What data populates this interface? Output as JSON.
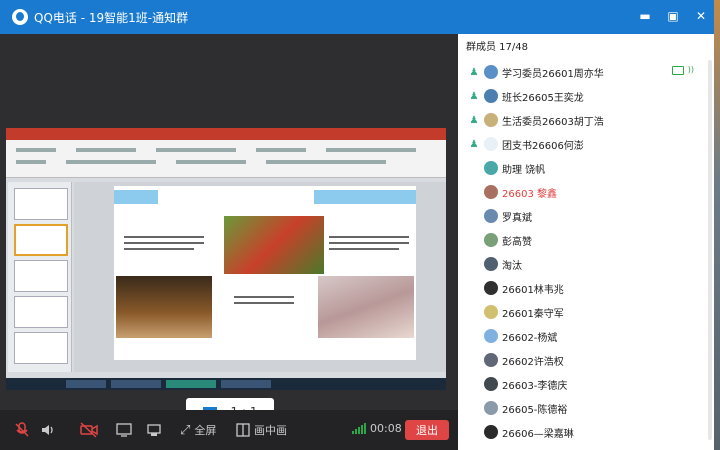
{
  "window": {
    "title": "QQ电话 - 19智能1班-通知群",
    "controls": [
      "▬",
      "▣",
      "✕"
    ]
  },
  "video": {
    "zoom_label": "1 : 1"
  },
  "toolbar": {
    "fullscreen_label": "全屏",
    "pip_label": "画中画",
    "timer": "00:08",
    "exit_label": "退出"
  },
  "members": {
    "header": "群成员 17/48",
    "list": [
      {
        "name": "学习委员26601周亦华",
        "owner": true,
        "color": "#5a8fc8",
        "highlight": false
      },
      {
        "name": "班长26605王奕龙",
        "owner": true,
        "color": "#4a7fb0",
        "highlight": false
      },
      {
        "name": "生活委员26603胡丁浩",
        "owner": true,
        "color": "#c8b07a",
        "highlight": false
      },
      {
        "name": "团支书26606何澎",
        "owner": true,
        "color": "#e8f0f8",
        "highlight": false
      },
      {
        "name": "助理  饶帆",
        "owner": false,
        "color": "#4aa8a8",
        "highlight": false
      },
      {
        "name": "26603 黎鑫",
        "owner": false,
        "color": "#a87060",
        "highlight": true
      },
      {
        "name": "罗真斌",
        "owner": false,
        "color": "#6a8ab0",
        "highlight": false
      },
      {
        "name": "彭高赞",
        "owner": false,
        "color": "#7aa07a",
        "highlight": false
      },
      {
        "name": "淘汰",
        "owner": false,
        "color": "#506070",
        "highlight": false
      },
      {
        "name": "26601林韦兆",
        "owner": false,
        "color": "#303030",
        "highlight": false
      },
      {
        "name": "26601秦守军",
        "owner": false,
        "color": "#d0c070",
        "highlight": false
      },
      {
        "name": "26602-杨斌",
        "owner": false,
        "color": "#80b0e0",
        "highlight": false
      },
      {
        "name": "26602许浩权",
        "owner": false,
        "color": "#606878",
        "highlight": false
      },
      {
        "name": "26603-李德庆",
        "owner": false,
        "color": "#404850",
        "highlight": false
      },
      {
        "name": "26605-陈德裕",
        "owner": false,
        "color": "#8a9aa8",
        "highlight": false
      },
      {
        "name": "26606—梁嘉琳",
        "owner": false,
        "color": "#2a2a2a",
        "highlight": false
      }
    ]
  },
  "colors": {
    "titlebar": "#1a7ad0",
    "exit": "#e04545",
    "signal": "#2aa84a",
    "mic_muted": "#e04545"
  }
}
